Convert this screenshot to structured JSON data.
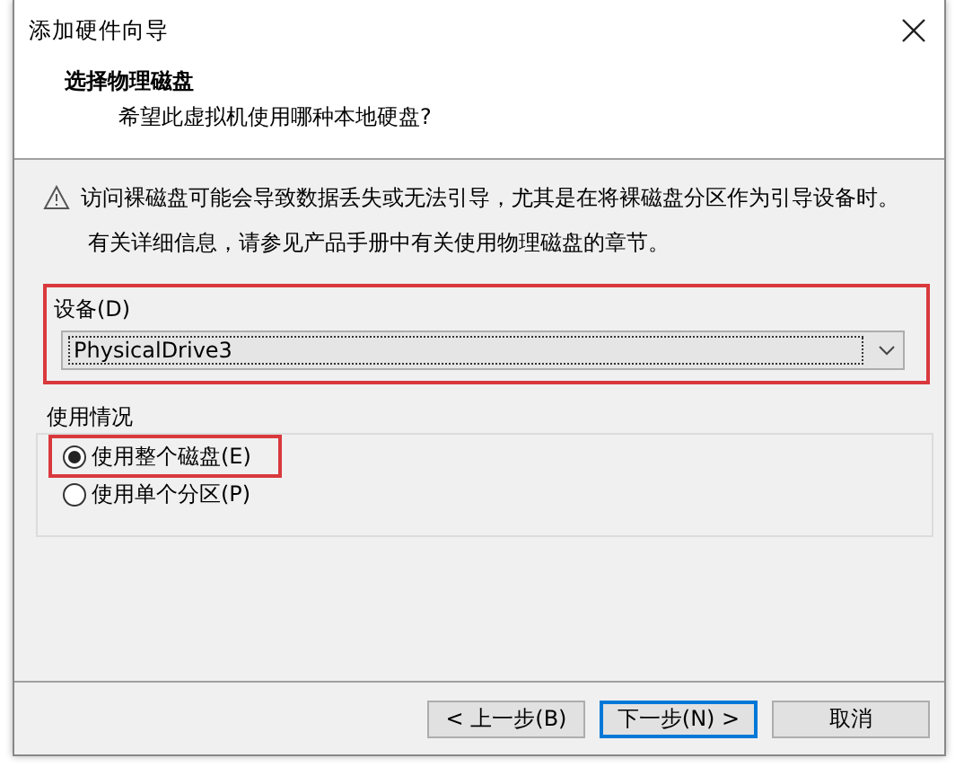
{
  "window": {
    "title": "添加硬件向导"
  },
  "header": {
    "title": "选择物理磁盘",
    "subtitle": "希望此虚拟机使用哪种本地硬盘?"
  },
  "warning": "访问裸磁盘可能会导致数据丢失或无法引导，尤其是在将裸磁盘分区作为引导设备时。",
  "info": "有关详细信息，请参见产品手册中有关使用物理磁盘的章节。",
  "device": {
    "label": "设备(D)",
    "value": "PhysicalDrive3",
    "highlighted": true
  },
  "usage": {
    "label": "使用情况",
    "options": [
      {
        "label": "使用整个磁盘(E)",
        "selected": true,
        "highlighted": true
      },
      {
        "label": "使用单个分区(P)",
        "selected": false,
        "highlighted": false
      }
    ]
  },
  "buttons": [
    {
      "label": "< 上一步(B)",
      "default": false
    },
    {
      "label": "下一步(N) >",
      "default": true
    },
    {
      "label": "取消",
      "default": false
    }
  ]
}
